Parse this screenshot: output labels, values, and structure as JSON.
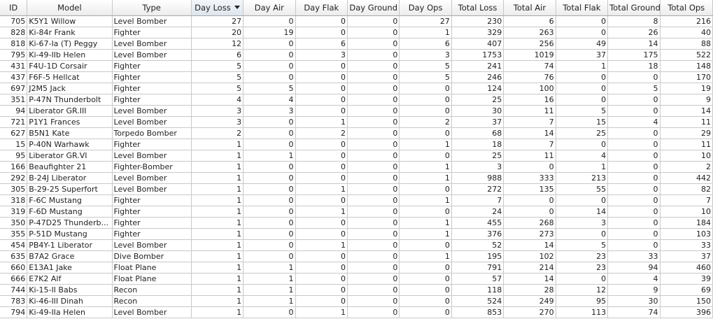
{
  "table": {
    "sort": {
      "column": "Day Loss",
      "direction": "descending",
      "indicator": "sort-down-arrow"
    },
    "columns": [
      "ID",
      "Model",
      "Type",
      "Day Loss",
      "Day Air",
      "Day Flak",
      "Day Ground",
      "Day Ops",
      "Total Loss",
      "Total Air",
      "Total Flak",
      "Total Ground",
      "Total Ops"
    ],
    "rows": [
      [
        "705",
        "K5Y1 Willow",
        "Level Bomber",
        "27",
        "0",
        "0",
        "0",
        "27",
        "230",
        "6",
        "0",
        "8",
        "216"
      ],
      [
        "828",
        "Ki-84r Frank",
        "Fighter",
        "20",
        "19",
        "0",
        "0",
        "1",
        "329",
        "263",
        "0",
        "26",
        "40"
      ],
      [
        "818",
        "Ki-67-Ia (T) Peggy",
        "Level Bomber",
        "12",
        "0",
        "6",
        "0",
        "6",
        "407",
        "256",
        "49",
        "14",
        "88"
      ],
      [
        "795",
        "Ki-49-IIb Helen",
        "Level Bomber",
        "6",
        "0",
        "3",
        "0",
        "3",
        "1753",
        "1019",
        "37",
        "175",
        "522"
      ],
      [
        "431",
        "F4U-1D Corsair",
        "Fighter",
        "5",
        "0",
        "0",
        "0",
        "5",
        "241",
        "74",
        "1",
        "18",
        "148"
      ],
      [
        "437",
        "F6F-5 Hellcat",
        "Fighter",
        "5",
        "0",
        "0",
        "0",
        "5",
        "246",
        "76",
        "0",
        "0",
        "170"
      ],
      [
        "697",
        "J2M5 Jack",
        "Fighter",
        "5",
        "5",
        "0",
        "0",
        "0",
        "124",
        "100",
        "0",
        "5",
        "19"
      ],
      [
        "351",
        "P-47N Thunderbolt",
        "Fighter",
        "4",
        "4",
        "0",
        "0",
        "0",
        "25",
        "16",
        "0",
        "0",
        "9"
      ],
      [
        "94",
        "Liberator GR.III",
        "Level Bomber",
        "3",
        "3",
        "0",
        "0",
        "0",
        "30",
        "11",
        "5",
        "0",
        "14"
      ],
      [
        "721",
        "P1Y1 Frances",
        "Level Bomber",
        "3",
        "0",
        "1",
        "0",
        "2",
        "37",
        "7",
        "15",
        "4",
        "11"
      ],
      [
        "627",
        "B5N1 Kate",
        "Torpedo Bomber",
        "2",
        "0",
        "2",
        "0",
        "0",
        "68",
        "14",
        "25",
        "0",
        "29"
      ],
      [
        "15",
        "P-40N Warhawk",
        "Fighter",
        "1",
        "0",
        "0",
        "0",
        "1",
        "18",
        "7",
        "0",
        "0",
        "11"
      ],
      [
        "95",
        "Liberator GR.VI",
        "Level Bomber",
        "1",
        "1",
        "0",
        "0",
        "0",
        "25",
        "11",
        "4",
        "0",
        "10"
      ],
      [
        "166",
        "Beaufighter 21",
        "Fighter-Bomber",
        "1",
        "0",
        "0",
        "0",
        "1",
        "3",
        "0",
        "1",
        "0",
        "2"
      ],
      [
        "292",
        "B-24J Liberator",
        "Level Bomber",
        "1",
        "0",
        "0",
        "0",
        "1",
        "988",
        "333",
        "213",
        "0",
        "442"
      ],
      [
        "305",
        "B-29-25 Superfort",
        "Level Bomber",
        "1",
        "0",
        "1",
        "0",
        "0",
        "272",
        "135",
        "55",
        "0",
        "82"
      ],
      [
        "318",
        "F-6C Mustang",
        "Fighter",
        "1",
        "0",
        "0",
        "0",
        "1",
        "7",
        "0",
        "0",
        "0",
        "7"
      ],
      [
        "319",
        "F-6D Mustang",
        "Fighter",
        "1",
        "0",
        "1",
        "0",
        "0",
        "24",
        "0",
        "14",
        "0",
        "10"
      ],
      [
        "350",
        "P-47D25 Thunderb...",
        "Fighter",
        "1",
        "0",
        "0",
        "0",
        "1",
        "455",
        "268",
        "3",
        "0",
        "184"
      ],
      [
        "355",
        "P-51D Mustang",
        "Fighter",
        "1",
        "0",
        "0",
        "0",
        "1",
        "376",
        "273",
        "0",
        "0",
        "103"
      ],
      [
        "454",
        "PB4Y-1 Liberator",
        "Level Bomber",
        "1",
        "0",
        "1",
        "0",
        "0",
        "52",
        "14",
        "5",
        "0",
        "33"
      ],
      [
        "635",
        "B7A2 Grace",
        "Dive Bomber",
        "1",
        "0",
        "0",
        "0",
        "1",
        "195",
        "102",
        "23",
        "33",
        "37"
      ],
      [
        "660",
        "E13A1 Jake",
        "Float Plane",
        "1",
        "1",
        "0",
        "0",
        "0",
        "791",
        "214",
        "23",
        "94",
        "460"
      ],
      [
        "666",
        "E7K2 Alf",
        "Float Plane",
        "1",
        "1",
        "0",
        "0",
        "0",
        "57",
        "14",
        "0",
        "4",
        "39"
      ],
      [
        "744",
        "Ki-15-II Babs",
        "Recon",
        "1",
        "1",
        "0",
        "0",
        "0",
        "118",
        "28",
        "12",
        "9",
        "69"
      ],
      [
        "783",
        "Ki-46-III Dinah",
        "Recon",
        "1",
        "1",
        "0",
        "0",
        "0",
        "524",
        "249",
        "95",
        "30",
        "150"
      ],
      [
        "794",
        "Ki-49-IIa Helen",
        "Level Bomber",
        "1",
        "0",
        "1",
        "0",
        "0",
        "853",
        "270",
        "113",
        "74",
        "396"
      ]
    ]
  }
}
